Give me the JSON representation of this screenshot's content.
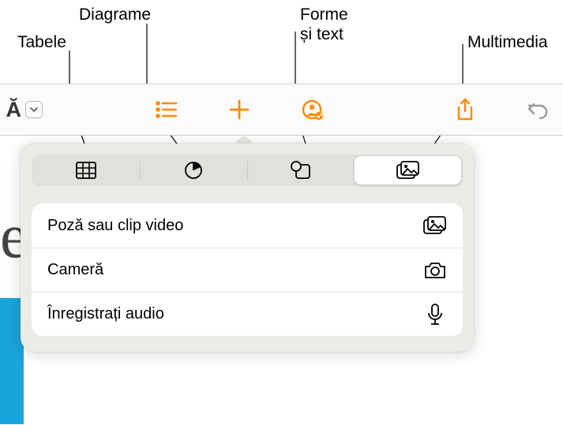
{
  "callouts": {
    "tabele": "Tabele",
    "diagrame": "Diagrame",
    "forme": "Forme\nși text",
    "multimedia": "Multimedia"
  },
  "toolbar": {
    "cropped_text": "Ă",
    "icons": {
      "list": "list-icon",
      "plus": "plus-icon",
      "collab": "collaborate-icon",
      "share": "share-icon",
      "undo": "undo-icon"
    }
  },
  "segmented": {
    "tabs": [
      {
        "name": "table-tab",
        "icon": "table-icon"
      },
      {
        "name": "chart-tab",
        "icon": "pie-icon"
      },
      {
        "name": "shapes-tab",
        "icon": "shape-icon"
      },
      {
        "name": "media-tab",
        "icon": "media-icon",
        "selected": true
      }
    ]
  },
  "options": [
    {
      "label": "Poză sau clip video",
      "icon": "photos-icon"
    },
    {
      "label": "Cameră",
      "icon": "camera-icon"
    },
    {
      "label": "Înregistrați audio",
      "icon": "microphone-icon"
    }
  ],
  "colors": {
    "accent": "#ff8a00",
    "segment_bg": "#e1e0dd",
    "popover_bg": "#ecebe8"
  }
}
